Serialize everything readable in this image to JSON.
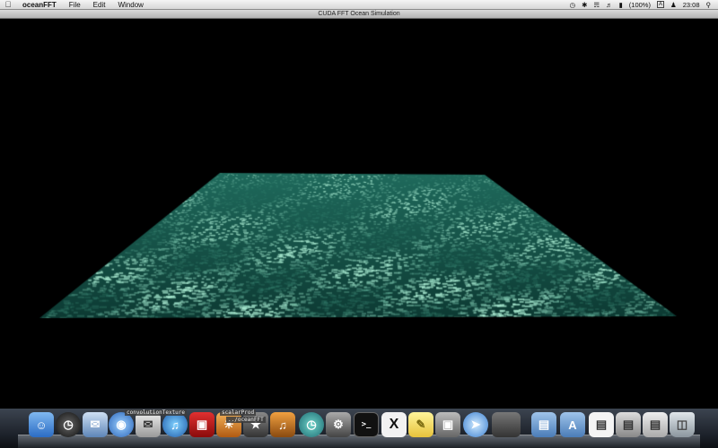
{
  "menubar": {
    "app_name": "oceanFFT",
    "items": [
      "File",
      "Edit",
      "Window"
    ],
    "battery": "(100%)",
    "input_indicator": "A",
    "clock": "23:08"
  },
  "window": {
    "title": "CUDA FFT Ocean Simulation"
  },
  "dock": {
    "label_convolution": "convolutionTexture",
    "label_scalar": "scalarProd",
    "label_terminal_path": "../oceanFFT"
  },
  "colors": {
    "ocean_dark": "#0d3a33",
    "ocean_mid": "#1f6a5c",
    "ocean_highlight": "#8fdcc8"
  }
}
